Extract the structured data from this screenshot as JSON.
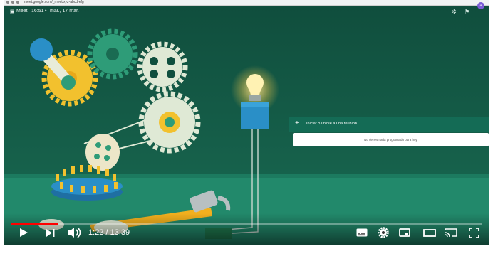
{
  "browser": {
    "url": "meet.google.com/_meet/xyz-abcd-efg"
  },
  "meet": {
    "app_name": "Meet",
    "time": "16:51",
    "separator": "•",
    "date": "mar., 17 mar."
  },
  "panel": {
    "join_label": "Iniciar o unirse a una reunión",
    "empty_label": "No tienes nada programado para hoy"
  },
  "player": {
    "current_time": "1:22",
    "duration": "13:39",
    "time_display": "1:22 / 13:39",
    "progress": 0.1
  },
  "colors": {
    "scene_bg": "#0f4f3e",
    "panel_header": "#146b55",
    "progress_red": "#ff0000"
  }
}
